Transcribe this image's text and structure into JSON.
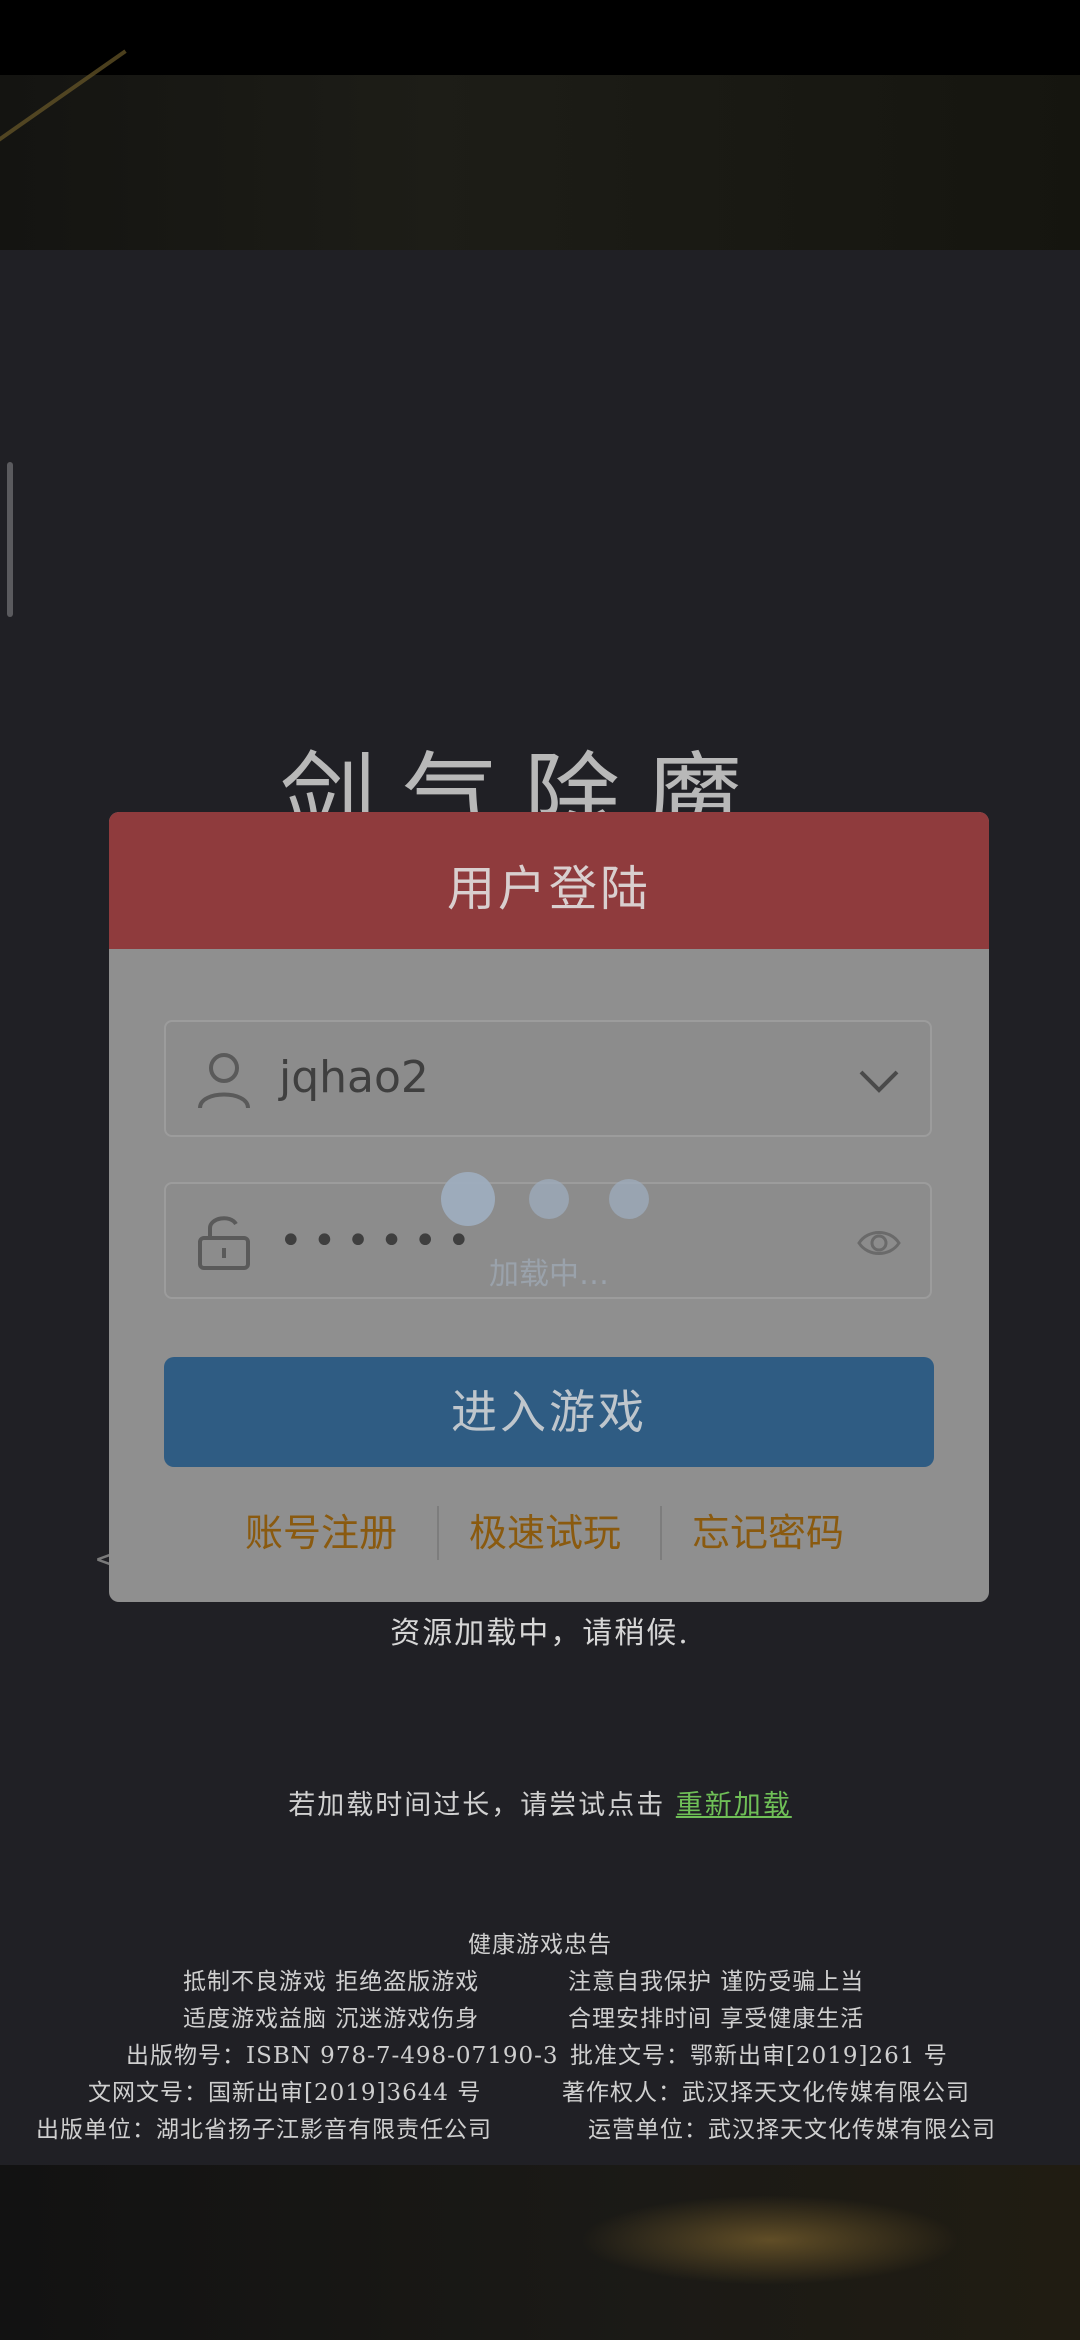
{
  "game": {
    "title": "剑气除魔"
  },
  "dialog": {
    "title": "用户登陆",
    "username_value": "jqhao2",
    "password_mask": "••••••",
    "loading_caption": "加载中…",
    "enter_button": "进入游戏",
    "links": {
      "register": "账号注册",
      "quick_play": "极速试玩",
      "forgot_password": "忘记密码"
    }
  },
  "loading": {
    "status": "资源加载中，请稍候.",
    "reload_prefix": "若加载时间过长，请尝试点击",
    "reload_link": "重新加载"
  },
  "notice": {
    "title": "健康游戏忠告",
    "line1_left": "抵制不良游戏 拒绝盗版游戏",
    "line1_right": "注意自我保护 谨防受骗上当",
    "line2_left": "适度游戏益脑 沉迷游戏伤身",
    "line2_right": "合理安排时间 享受健康生活",
    "line3_left": "出版物号：ISBN 978-7-498-07190-3",
    "line3_right": "批准文号：鄂新出审[2019]261 号",
    "line4_left": "文网文号：国新出审[2019]3644 号",
    "line4_right": "著作权人：武汉择天文化传媒有限公司",
    "line5_left": "出版单位：湖北省扬子江影音有限责任公司",
    "line5_right": "运营单位：武汉择天文化传媒有限公司"
  },
  "colors": {
    "dialog_header": "#8f3b3d",
    "enter_button": "#2f5c83",
    "link": "#8a5a0f",
    "reload_link": "#6fbf57"
  },
  "icons": {
    "user": "user-icon",
    "dropdown": "chevron-down-icon",
    "lock": "lock-icon",
    "show_password": "eye-icon"
  }
}
